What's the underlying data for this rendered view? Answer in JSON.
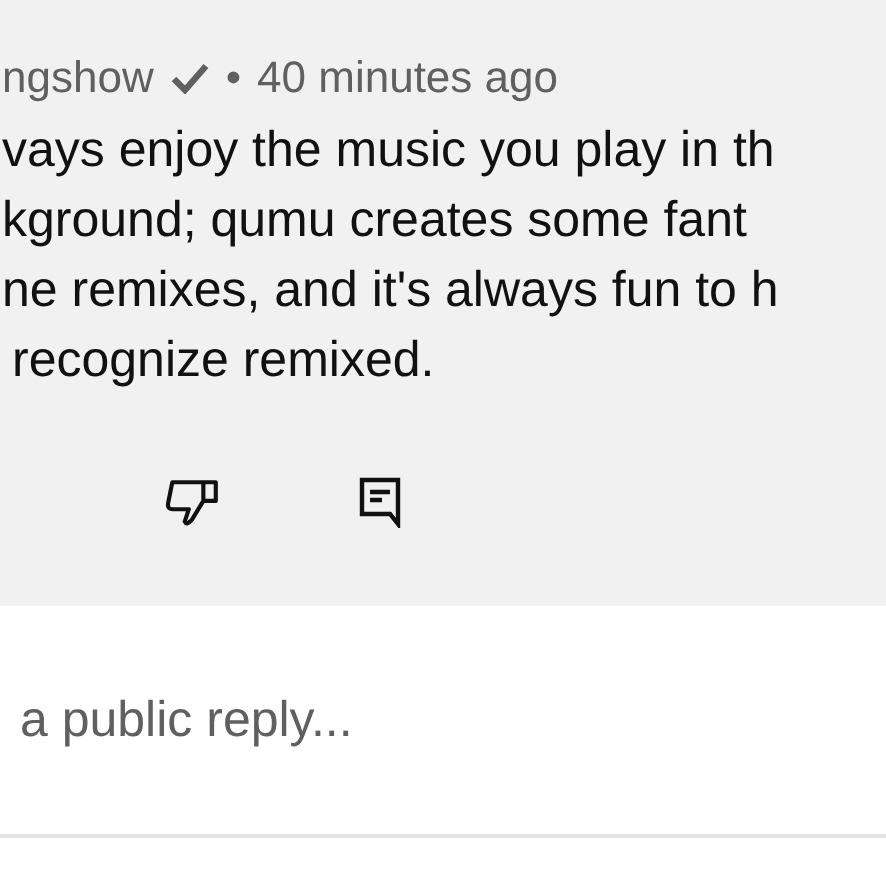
{
  "comment": {
    "author": "ngshow",
    "verified": true,
    "separator": "•",
    "time": "40 minutes ago",
    "lines": [
      "vays enjoy the music you play in th",
      "kground; qumu creates some fant",
      "ne remixes, and it's always fun to h",
      "recognize remixed."
    ]
  },
  "reply_box": {
    "placeholder": "a public reply..."
  }
}
